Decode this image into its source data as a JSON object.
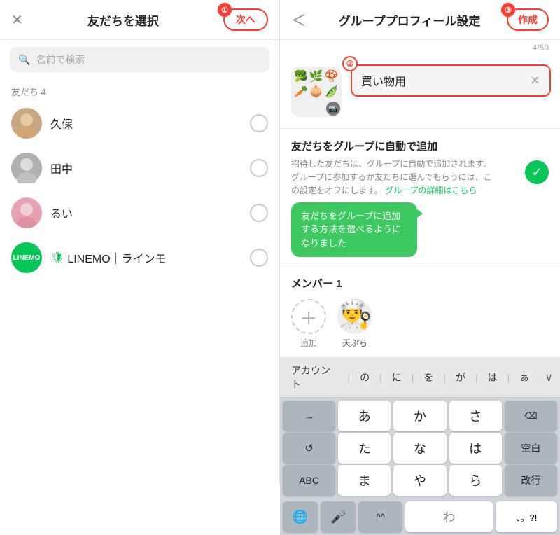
{
  "left": {
    "close_icon": "✕",
    "title": "友だちを選択",
    "next_button": "次へ",
    "next_badge": "①",
    "search_placeholder": "名前で検索",
    "section_label": "友だち 4",
    "friends": [
      {
        "name": "久保",
        "has_avatar": true
      },
      {
        "name": "田中",
        "has_avatar": false
      },
      {
        "name": "るい",
        "has_avatar": true
      }
    ],
    "linemo": {
      "name": "LINEMO｜ラインモ",
      "icon_text": "L"
    }
  },
  "right": {
    "back_icon": "＜",
    "title": "グループプロフィール設定",
    "create_button": "作成",
    "create_badge": "③",
    "char_count": "4/50",
    "group_name": "買い物用",
    "name_badge": "②",
    "camera_icon": "📷",
    "auto_add": {
      "title": "友だちをグループに自動で追加",
      "desc_line1": "招待した友だちは、グループに自動で追加されます。",
      "desc_line2": "グループに参加するか友だちに選んでもらうには、こ",
      "desc_line3": "の設定をオフにします。",
      "link_text": "グループの詳細はこちら",
      "tooltip": "友だちをグループに追加する方法を選べるようになりました"
    },
    "members": {
      "title": "メンバー 1",
      "add_label": "追加",
      "member_name": "天ぷら"
    }
  },
  "keyboard": {
    "suggestions": [
      "アカウント",
      "の",
      "に",
      "を",
      "が",
      "は",
      "ぁ"
    ],
    "rows": [
      [
        "→",
        "あ",
        "か",
        "さ",
        "⌫"
      ],
      [
        "↺",
        "た",
        "な",
        "は",
        "空白"
      ],
      [
        "ABC",
        "ま",
        "や",
        "ら",
        "改行"
      ],
      [
        "🌐",
        "🎤",
        "^^",
        "わ",
        "、。?!"
      ]
    ]
  }
}
